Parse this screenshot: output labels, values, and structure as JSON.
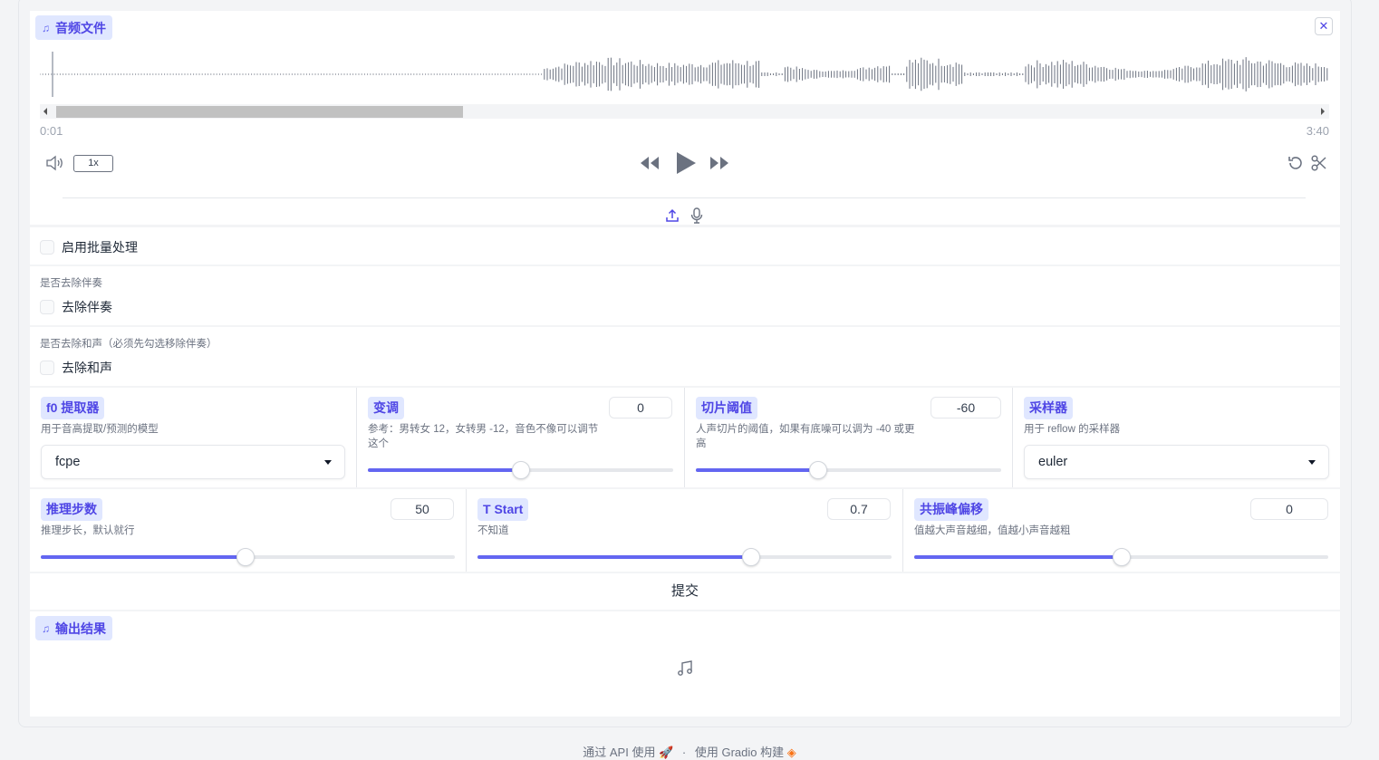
{
  "audio_input": {
    "label": "音频文件",
    "time_current": "0:01",
    "time_total": "3:40",
    "speed": "1x"
  },
  "batch": {
    "label": "启用批量处理"
  },
  "remove_accompaniment": {
    "title": "是否去除伴奏",
    "label": "去除伴奏"
  },
  "remove_harmony": {
    "title": "是否去除和声（必须先勾选移除伴奏）",
    "label": "去除和声"
  },
  "f0_extractor": {
    "label": "f0 提取器",
    "info": "用于音高提取/预测的模型",
    "value": "fcpe"
  },
  "pitch": {
    "label": "变调",
    "info_line1": "参考：男转女 12，女转男 -12，音色不像可以调节",
    "info_line2": "这个",
    "value": "0",
    "fraction": 0.5
  },
  "slice_threshold": {
    "label": "切片阈值",
    "info_line1": "人声切片的阈值，如果有底噪可以调为 -40 或更",
    "info_line2": "高",
    "value": "-60",
    "fraction": 0.4
  },
  "sampler": {
    "label": "采样器",
    "info": "用于 reflow 的采样器",
    "value": "euler"
  },
  "infer_steps": {
    "label": "推理步数",
    "info": "推理步长，默认就行",
    "value": "50",
    "fraction": 0.495
  },
  "t_start": {
    "label": "T Start",
    "info": "不知道",
    "value": "0.7",
    "fraction": 0.66
  },
  "formant_shift": {
    "label": "共振峰偏移",
    "info": "值越大声音越细，值越小声音越粗",
    "value": "0",
    "fraction": 0.5
  },
  "submit": {
    "label": "提交"
  },
  "output": {
    "label": "输出结果"
  },
  "footer": {
    "api_text": "通过 API 使用",
    "separator": "·",
    "built_text": "使用 Gradio 构建"
  },
  "icons": {
    "music": "music-note-icon",
    "close": "close-icon",
    "volume": "volume-icon",
    "rewind": "rewind-icon",
    "play": "play-icon",
    "forward": "fast-forward-icon",
    "reset": "undo-icon",
    "trim": "scissors-icon",
    "upload": "upload-icon",
    "mic": "microphone-icon"
  },
  "colors": {
    "accent": "#6366f1",
    "chip_bg": "#e0e7ff",
    "chip_text": "#4f46e5"
  }
}
